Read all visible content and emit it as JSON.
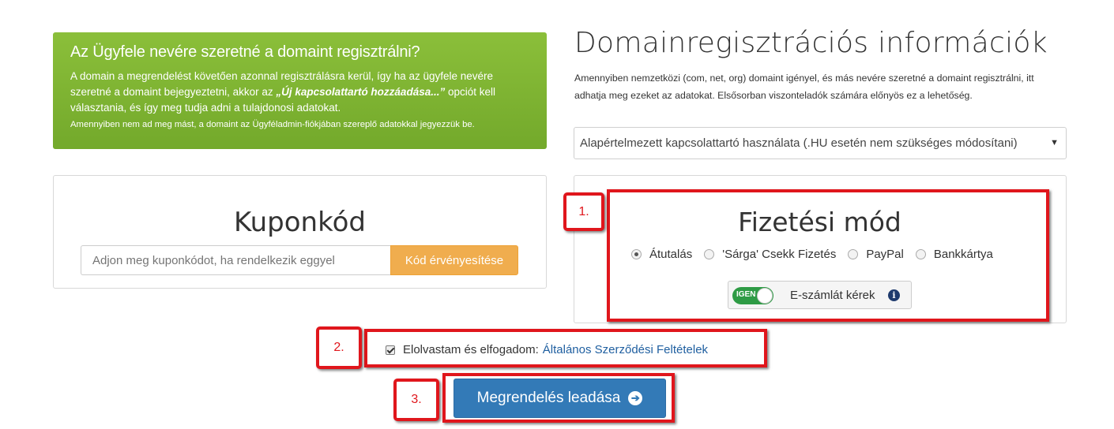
{
  "info_panel": {
    "title": "Az Ügyfele nevére szeretné a domaint regisztrálni?",
    "text_before": "A domain a megrendelést követően azonnal regisztrálásra kerül, így ha az ügyfele nevére szeretné a domaint bejegyeztetni, akkor az ",
    "text_emphasis": "„Új kapcsolattartó hozzáadása...”",
    "text_after": " opciót kell választania, és így meg tudja adni a tulajdonosi adatokat.",
    "note": "Amennyiben nem ad meg mást, a domaint az Ügyféladmin-fiókjában szereplő adatokkal jegyezzük be."
  },
  "domain_info": {
    "title": "Domainregisztrációs információk",
    "description": "Amennyiben nemzetközi (com, net, org) domaint igényel, és más nevére szeretné a domaint regisztrálni, itt adhatja meg ezeket az adatokat. Elsősorban viszonteladók számára előnyös ez a lehetőség.",
    "select_value": "Alapértelmezett kapcsolattartó használata (.HU esetén nem szükséges módosítani)"
  },
  "coupon": {
    "title": "Kuponkód",
    "placeholder": "Adjon meg kuponkódot, ha rendelkezik eggyel",
    "button_label": "Kód érvényesítése"
  },
  "payment": {
    "title": "Fizetési mód",
    "options": [
      {
        "label": "Átutalás",
        "selected": true
      },
      {
        "label": "'Sárga' Csekk Fizetés",
        "selected": false
      },
      {
        "label": "PayPal",
        "selected": false
      },
      {
        "label": "Bankkártya",
        "selected": false
      }
    ],
    "toggle_label": "IGEN",
    "invoice_label": "E-számlát kérek",
    "info_icon": "i"
  },
  "terms": {
    "text": "Elolvastam és elfogadom:",
    "link": "Általános Szerződési Feltételek",
    "checked": true
  },
  "submit": {
    "label": "Megrendelés leadása"
  },
  "annotations": {
    "step1": "1.",
    "step2": "2.",
    "step3": "3."
  },
  "colors": {
    "annotation_red": "#e0161c",
    "primary_blue": "#337ab7",
    "coupon_orange": "#f0ad4e",
    "info_green": "#7db432",
    "toggle_green": "#2e9b45"
  }
}
